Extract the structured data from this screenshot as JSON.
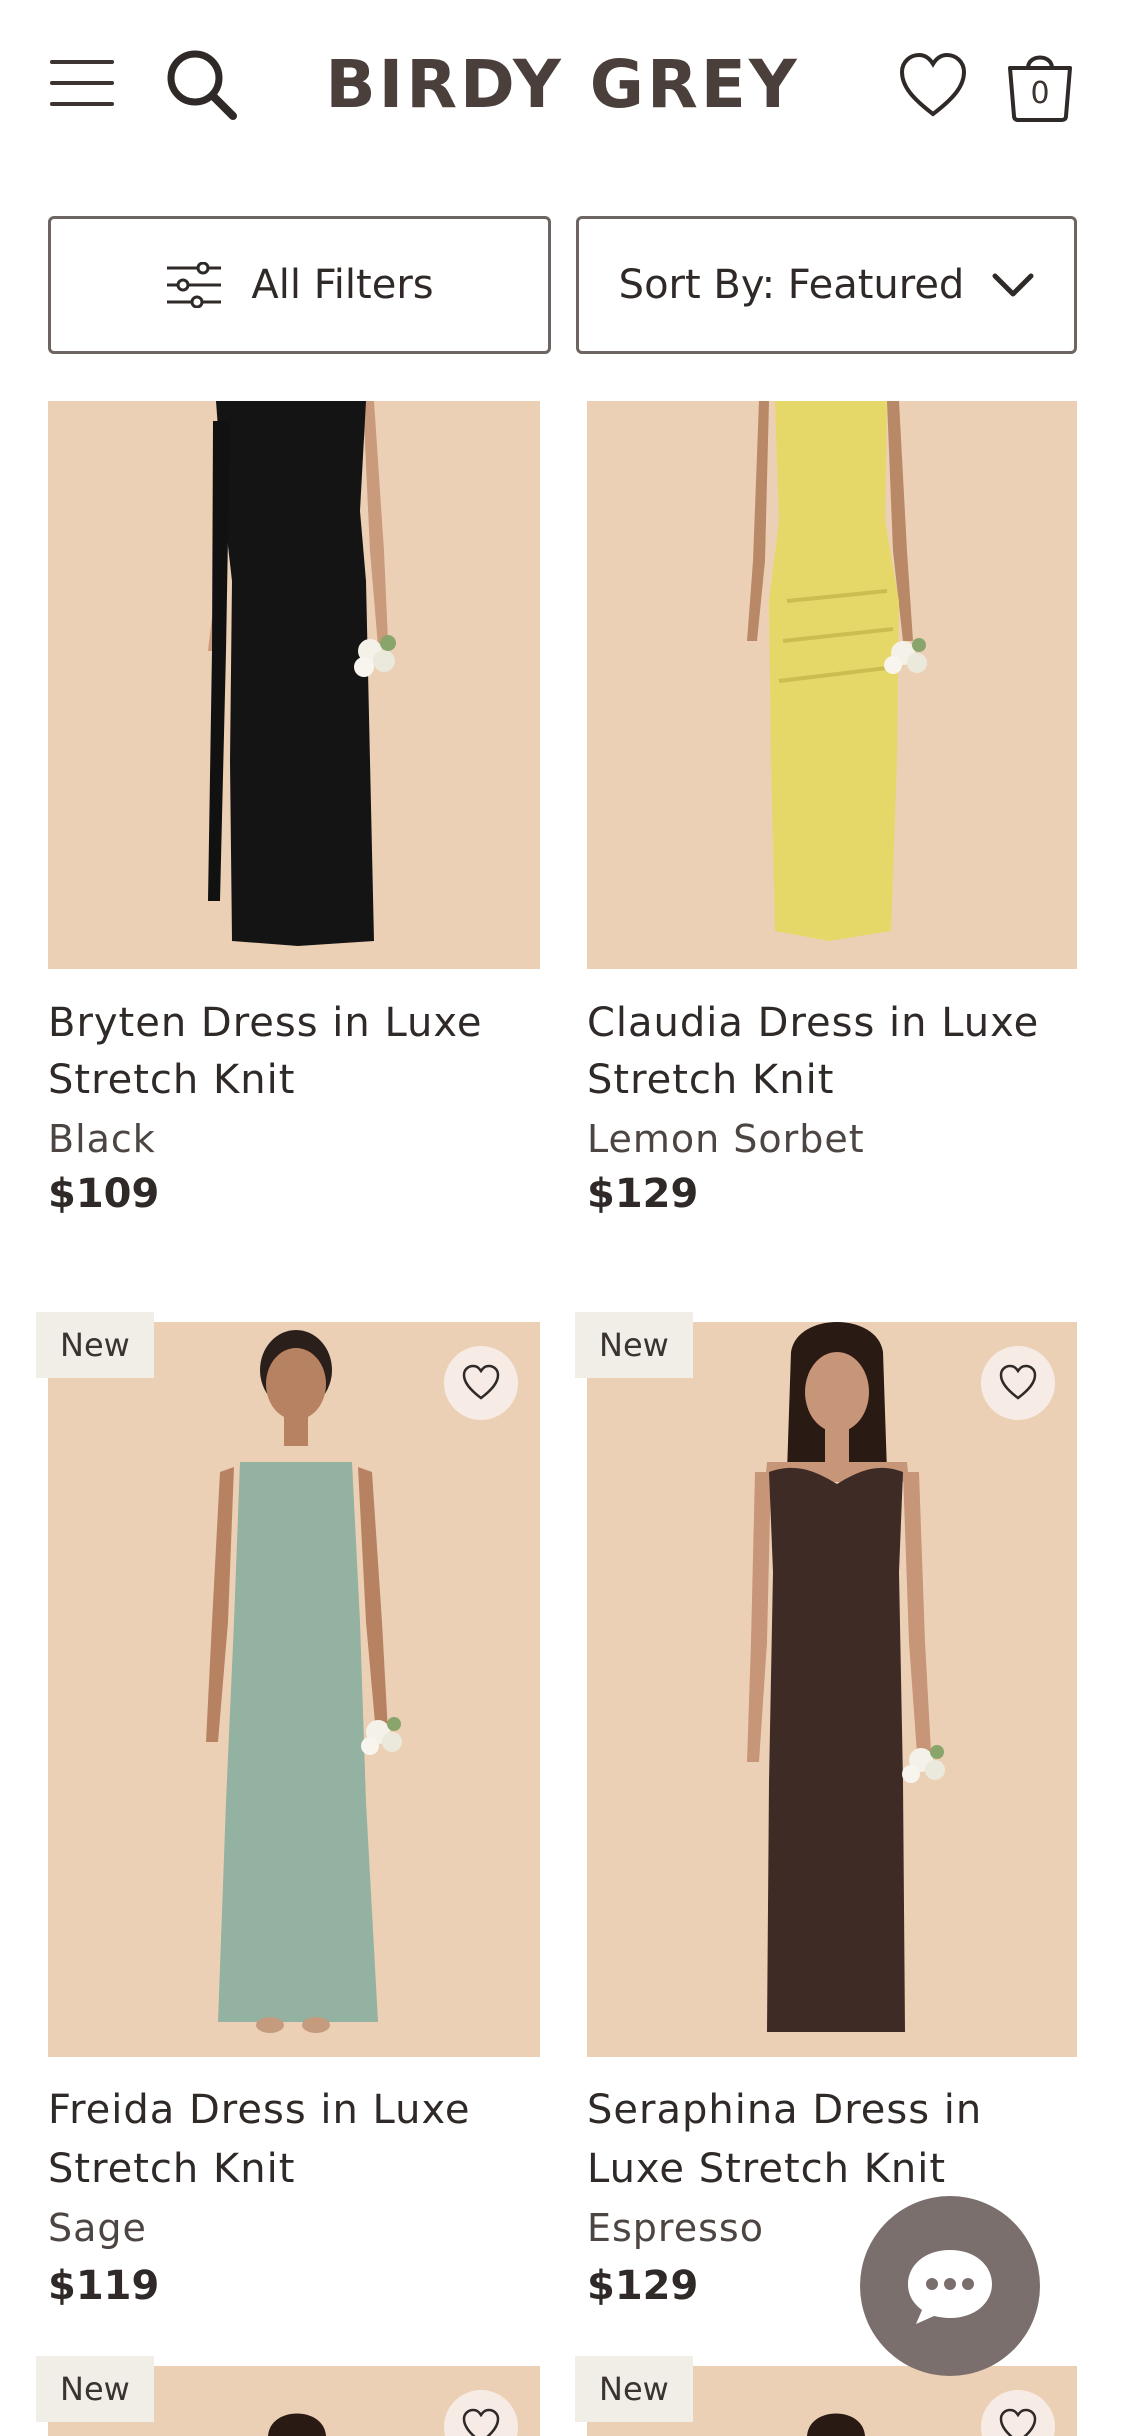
{
  "header": {
    "logo": "BIRDY GREY",
    "cart_count": "0"
  },
  "toolbar": {
    "filters_label": "All Filters",
    "sort_label": "Sort By: Featured"
  },
  "products": [
    {
      "title_line1": "Bryten Dress in Luxe",
      "title_line2": "Stretch Knit",
      "color": "Black",
      "price": "$109",
      "badge": "",
      "dress_color": "#151414"
    },
    {
      "title_line1": "Claudia Dress in Luxe",
      "title_line2": "Stretch Knit",
      "color": "Lemon Sorbet",
      "price": "$129",
      "badge": "",
      "dress_color": "#e5d869"
    },
    {
      "title_line1": "Freida Dress in Luxe",
      "title_line2": "Stretch Knit",
      "color": "Sage",
      "price": "$119",
      "badge": "New",
      "dress_color": "#93b2a1"
    },
    {
      "title_line1": "Seraphina Dress in",
      "title_line2": "Luxe Stretch Knit",
      "color": "Espresso",
      "price": "$129",
      "badge": "New",
      "dress_color": "#3f2b25"
    },
    {
      "badge": "New"
    },
    {
      "badge": "New"
    }
  ],
  "colors": {
    "image_background": "#ecd0b6",
    "badge_background": "#f1ede7",
    "chat_button": "#7a6f6c"
  }
}
